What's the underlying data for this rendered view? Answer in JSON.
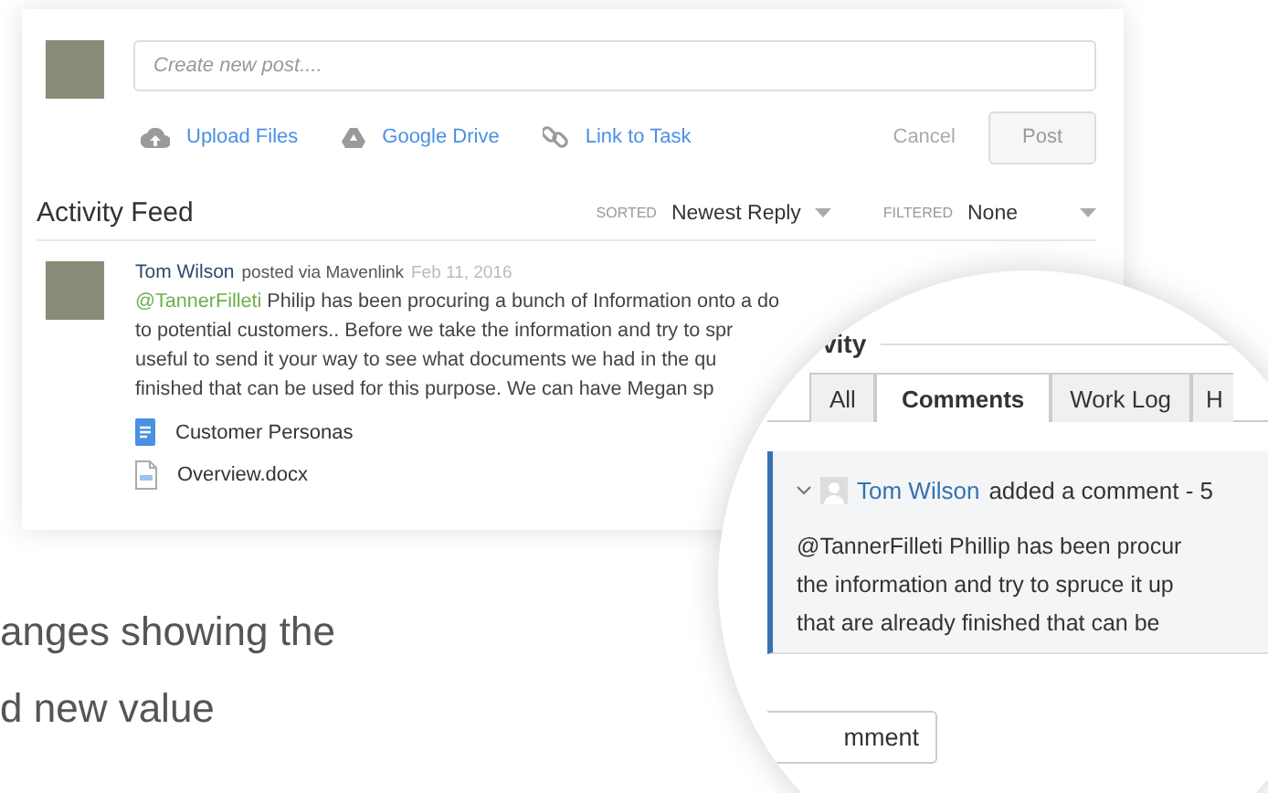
{
  "composer": {
    "placeholder": "Create new post....",
    "actions": [
      {
        "kind": "upload",
        "label": "Upload Files"
      },
      {
        "kind": "drive",
        "label": "Google Drive"
      },
      {
        "kind": "link",
        "label": "Link to Task"
      }
    ],
    "cancel": "Cancel",
    "post": {
      "label": "Post",
      "disabled": true
    }
  },
  "feed": {
    "title": "Activity Feed",
    "sort_label": "SORTED",
    "sort_value": "Newest Reply",
    "filter_label": "FILTERED",
    "filter_value": "None",
    "posts": [
      {
        "author": "Tom Wilson",
        "via": "posted via Mavenlink",
        "date": "Feb 11, 2016",
        "mention": "@TannerFilleti",
        "lines": [
          "Philip has been procuring a bunch of Information onto a do",
          "to potential customers.. Before we take the information and try to spr",
          "useful to send it your way to see what documents we had in the qu",
          "finished that can be used for this purpose. We can have Megan sp"
        ],
        "attachments": [
          {
            "kind": "gdoc",
            "name": "Customer Personas"
          },
          {
            "kind": "docx",
            "name": "Overview.docx"
          }
        ]
      }
    ]
  },
  "magnifier": {
    "heading": "vity",
    "tabs": [
      {
        "label": "All",
        "selected": false
      },
      {
        "label": "Comments",
        "selected": true
      },
      {
        "label": "Work Log",
        "selected": false
      },
      {
        "label": "H",
        "selected": false
      }
    ],
    "comment": {
      "author": "Tom Wilson",
      "action": "added a comment - 5",
      "lines": [
        "@TannerFilleti Phillip has been procur",
        "the information and try to spruce it up",
        "that are already finished that can be"
      ]
    },
    "button": "mment"
  },
  "caption_lines": [
    "anges showing the",
    "d new value"
  ]
}
